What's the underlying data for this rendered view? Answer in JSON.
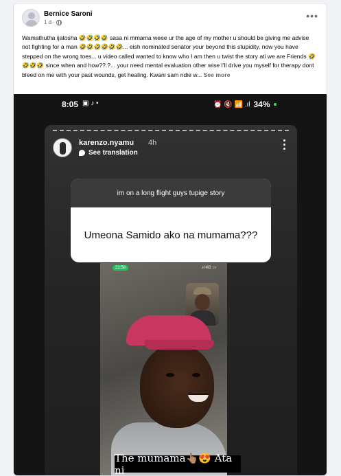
{
  "post": {
    "author": "Bernice Saroni",
    "time": "1 d",
    "separator": "·",
    "caption": "Wamathutha ijatosha 🤣🤣🤣🤣 sasa ni mmama weee ur the age of my mother u should be giving me advise not fighting for a man 🤣🤣🤣🤣🤣🤣... eish nominated senator your beyond this stupidity, now you have stepped on the wrong toes... u video called wanted to know who I am then u twist the story ati we are Friends 🤣🤣🤣🤣 since when and how??.?... your need mental evaluation other wise I'll drive you myself  for therapy dont bleed on me with your past wounds, get healing.  Kwani sam ndie w...",
    "see_more": "See more",
    "more_icon": "ellipsis-icon"
  },
  "phone_status": {
    "time": "8:05",
    "left_icons": "▣ ♪ •",
    "right_icons": "⏰ 🔇 📶 .ıl",
    "battery": "34%"
  },
  "story": {
    "username": "karenzo.nyamu",
    "age": "4h",
    "translation": "See translation",
    "question_prompt": "im on a long flight guys tupige story",
    "question_answer": "Umeona Samido ako na mumama???",
    "call_time": "23:58",
    "call_signal": ".ıl 4G ▭",
    "text_caption": "The mumama👆🏽😍 Ata ni"
  },
  "colors": {
    "card_bg": "#ffffff",
    "page_bg": "#f0f2f5",
    "photo_bg": "#141414",
    "call_pill": "#1fc35b"
  }
}
